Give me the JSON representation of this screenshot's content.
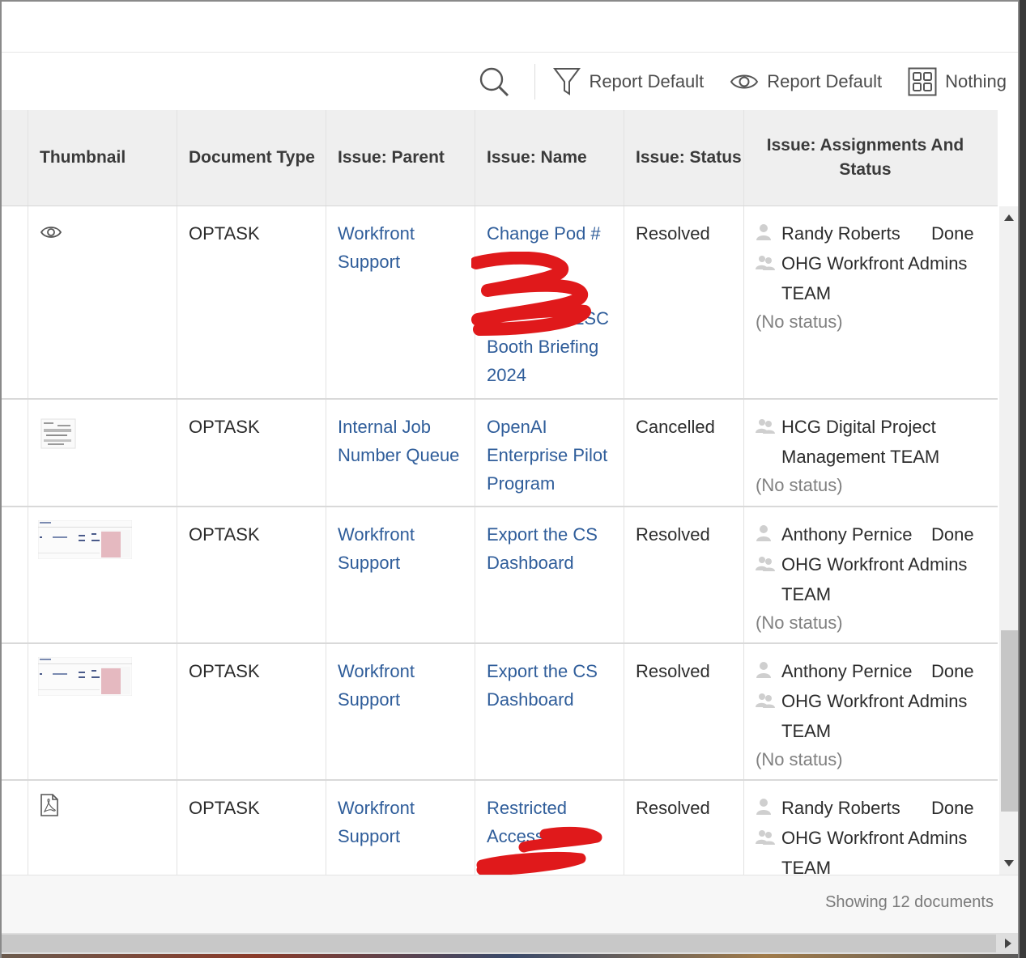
{
  "toolbar": {
    "filter_label": "Report Default",
    "view_label": "Report Default",
    "grouping_label": "Nothing"
  },
  "columns": {
    "thumbnail": "Thumbnail",
    "document_type": "Document Type",
    "issue_parent": "Issue: Parent",
    "issue_name": "Issue: Name",
    "issue_status": "Issue: Status",
    "assignments_line1": "Issue: Assignments And",
    "assignments_line2": "Status"
  },
  "rows": [
    {
      "thumbnail": "eye-icon",
      "doc_type": "OPTASK",
      "parent": [
        "Workfront",
        "Support"
      ],
      "name": [
        "Change Pod #",
        "",
        "",
        "ESC",
        "Booth Briefing",
        "2024"
      ],
      "status": "Resolved",
      "assignments": [
        {
          "type": "user",
          "name": "Randy Roberts",
          "status": "Done"
        },
        {
          "type": "team",
          "name": "OHG Workfront Admins",
          "extra": "TEAM"
        }
      ],
      "no_status": "(No status)"
    },
    {
      "thumbnail": "document-thumbnail",
      "doc_type": "OPTASK",
      "parent": [
        "Internal Job",
        "Number Queue"
      ],
      "name": [
        "OpenAI",
        "Enterprise Pilot",
        "Program"
      ],
      "status": "Cancelled",
      "assignments": [
        {
          "type": "team",
          "name": "HCG Digital Project",
          "extra": "Management TEAM"
        }
      ],
      "no_status": "(No status)"
    },
    {
      "thumbnail": "dashboard-thumbnail",
      "doc_type": "OPTASK",
      "parent": [
        "Workfront",
        "Support"
      ],
      "name": [
        "Export the CS",
        "Dashboard"
      ],
      "status": "Resolved",
      "assignments": [
        {
          "type": "user",
          "name": "Anthony Pernice",
          "status": "Done"
        },
        {
          "type": "team",
          "name": "OHG Workfront Admins",
          "extra": "TEAM"
        }
      ],
      "no_status": "(No status)"
    },
    {
      "thumbnail": "dashboard-thumbnail",
      "doc_type": "OPTASK",
      "parent": [
        "Workfront",
        "Support"
      ],
      "name": [
        "Export the CS",
        "Dashboard"
      ],
      "status": "Resolved",
      "assignments": [
        {
          "type": "user",
          "name": "Anthony Pernice",
          "status": "Done"
        },
        {
          "type": "team",
          "name": "OHG Workfront Admins",
          "extra": "TEAM"
        }
      ],
      "no_status": "(No status)"
    },
    {
      "thumbnail": "pdf-icon",
      "doc_type": "OPTASK",
      "parent": [
        "Workfront",
        "Support"
      ],
      "name": [
        "Restricted",
        "Access:"
      ],
      "status": "Resolved",
      "assignments": [
        {
          "type": "user",
          "name": "Randy Roberts",
          "status": "Done"
        },
        {
          "type": "team",
          "name": "OHG Workfront Admins",
          "extra": "TEAM"
        }
      ]
    }
  ],
  "footer": {
    "showing_text": "Showing 12 documents"
  }
}
